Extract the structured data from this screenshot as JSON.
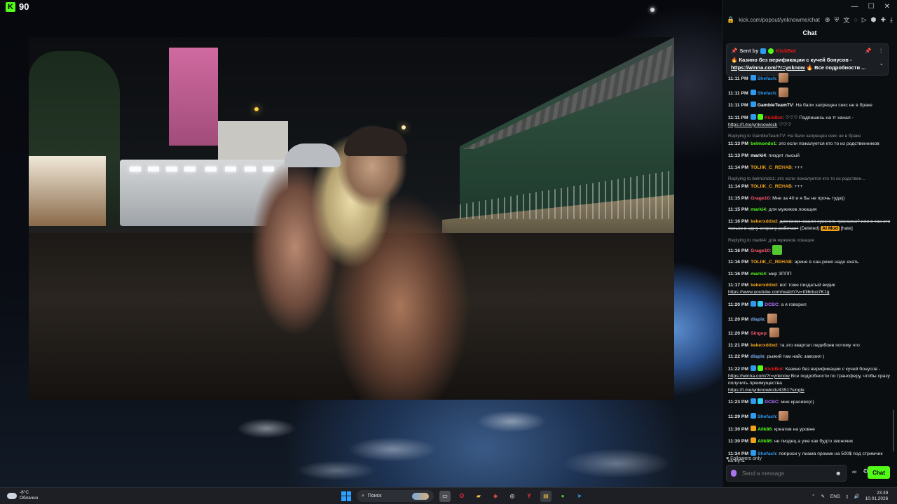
{
  "overlay": {
    "app_logo": "K",
    "fps": "90"
  },
  "browser": {
    "url": "kick.com/popout/ynknowme/chat",
    "window_buttons": [
      "minimize-icon",
      "maximize-icon",
      "close-icon"
    ]
  },
  "chat": {
    "title": "Chat",
    "pinned": {
      "sent_by_label": "Sent by",
      "sender": "KickBot",
      "text_prefix": "Казино без верификации с кучей бонусов -",
      "link": "https://winna.com/?r=ynknow",
      "text_suffix": "Все подробности ..."
    },
    "messages": [
      {
        "time": "11:11 PM",
        "user": "Shefach",
        "user_color": "#2d9bf0",
        "badges": [
          "#2d9bf0"
        ],
        "text": "",
        "emote": true
      },
      {
        "time": "11:11 PM",
        "user": "Shefach",
        "user_color": "#2d9bf0",
        "badges": [
          "#2d9bf0"
        ],
        "text": "",
        "emote": true
      },
      {
        "time": "11:11 PM",
        "user": "GambleTeamTV",
        "user_color": "#ffffff",
        "badges": [
          "#2d9bf0"
        ],
        "text": "На бали запрещен секс не в браке"
      },
      {
        "time": "11:11 PM",
        "user": "KickBot",
        "user_color": "#e91916",
        "badges": [
          "#2d9bf0",
          "#53fc18"
        ],
        "text": "♡♡♡ Подпишись на тг канал -",
        "link": "https://t.me/ynknowkick",
        "suffix": "♡♡♡"
      },
      {
        "reply": "Replying to GambleTeamTV: На бали запрещен секс не в браке",
        "time": "11:13 PM",
        "user": "belmondo1",
        "user_color": "#53fc18",
        "badges": [],
        "text": "это если пожалуется кто то из родственников"
      },
      {
        "time": "11:13 PM",
        "user": "marki4",
        "user_color": "#ffffff",
        "badges": [],
        "text": "пиздит лысый"
      },
      {
        "time": "11:14 PM",
        "user": "TOLIIK_C_REHAB",
        "user_color": "#f0a21b",
        "badges": [],
        "text": "+++"
      },
      {
        "reply": "Replying to belmondo1: это если пожалуется кто то из родствен...",
        "time": "11:14 PM",
        "user": "TOLIIK_C_REHAB",
        "user_color": "#f0a21b",
        "badges": [],
        "text": "+++"
      },
      {
        "time": "11:15 PM",
        "user": "Grage10",
        "user_color": "#ff5a6e",
        "badges": [],
        "text": "Мне за 40 и я бы не прочь туда))"
      },
      {
        "time": "11:15 PM",
        "user": "marki4",
        "user_color": "#53fc18",
        "badges": [],
        "text": "для мужиков локация"
      },
      {
        "time": "11:16 PM",
        "user": "kekerxddxd",
        "user_color": "#f0a21b",
        "badges": [],
        "strike": "девчонки нашли хуэстого трансика? или в тае это только в одну сторону работает",
        "deleted": "(Deleted)",
        "mod": "AI Mod",
        "hate": "[hate]"
      },
      {
        "reply": "Replying to marki4: для мужиков локация",
        "time": "11:16 PM",
        "user": "Grage10",
        "user_color": "#ff5a6e",
        "badges": [],
        "text": "",
        "emote": true,
        "emote_color": "#53c830"
      },
      {
        "time": "11:16 PM",
        "user": "TOLIIK_C_REHAB",
        "user_color": "#f0a21b",
        "badges": [],
        "text": "арине в сан-ремо надо ехать"
      },
      {
        "time": "11:16 PM",
        "user": "marki4",
        "user_color": "#53fc18",
        "badges": [],
        "text": "мир ЗППП"
      },
      {
        "time": "11:17 PM",
        "user": "kekerxddxd",
        "user_color": "#f0a21b",
        "badges": [],
        "text": "вот тоже пиздатый видик",
        "link": "https://www.youtube.com/watch?v=I0l6duo7K1g",
        "link_newline": true
      },
      {
        "time": "11:20 PM",
        "user": "DCBC",
        "user_color": "#b06cff",
        "badges": [
          "#2d9bf0",
          "#2dd0f0"
        ],
        "text": "а я говорил"
      },
      {
        "time": "11:20 PM",
        "user": "dispix",
        "user_color": "#7fb8ff",
        "badges": [],
        "text": "",
        "emote": true
      },
      {
        "time": "11:20 PM",
        "user": "Singep",
        "user_color": "#ff5a6e",
        "badges": [],
        "text": "",
        "emote": true
      },
      {
        "time": "11:21 PM",
        "user": "kekerxddxd",
        "user_color": "#f0a21b",
        "badges": [],
        "text": "та это квартал ледибоев потому что"
      },
      {
        "time": "11:22 PM",
        "user": "dispix",
        "user_color": "#7fb8ff",
        "badges": [],
        "text": "рыжий там найс завозил )"
      },
      {
        "time": "11:22 PM",
        "user": "KickBot",
        "user_color": "#e91916",
        "badges": [
          "#2d9bf0",
          "#53fc18"
        ],
        "text": "Казино без верификации с кучей бонусов -",
        "link": "https://winna.com/?r=ynknow",
        "suffix": "Все подробности по трансферу, чтобы сразу получить преимущества",
        "link2": "https://t.me/ynknowkick/4351?single"
      },
      {
        "time": "11:23 PM",
        "user": "DCBC",
        "user_color": "#b06cff",
        "badges": [
          "#2d9bf0",
          "#2dd0f0"
        ],
        "text": "мне красиво(с)"
      },
      {
        "time": "11:29 PM",
        "user": "Shefach",
        "user_color": "#2d9bf0",
        "badges": [
          "#2d9bf0"
        ],
        "text": "",
        "emote": true
      },
      {
        "time": "11:30 PM",
        "user": "Alik86",
        "user_color": "#53fc18",
        "badges": [
          "#f0a21b"
        ],
        "text": "креатив на уровне"
      },
      {
        "time": "11:30 PM",
        "user": "Alik86",
        "user_color": "#53fc18",
        "badges": [
          "#f0a21b"
        ],
        "text": "не пиздец а уже как будто звоночек"
      },
      {
        "time": "11:34 PM",
        "user": "Shefach",
        "user_color": "#2d9bf0",
        "badges": [
          "#2d9bf0"
        ],
        "text": "попроси у лиама промик на 500$ под стримчик катнуть"
      }
    ],
    "followers_only": "Followers only",
    "input_placeholder": "Send a message",
    "send_label": "Chat"
  },
  "taskbar": {
    "weather_temp": "-8°C",
    "weather_text": "Облачно",
    "search_placeholder": "Поиск",
    "language": "ENG",
    "time": "23:39",
    "date": "10.01.2026"
  },
  "colors": {
    "kick_green": "#53fc18",
    "chat_bg": "#0b0e11",
    "taskbar": "#1d1f24"
  }
}
